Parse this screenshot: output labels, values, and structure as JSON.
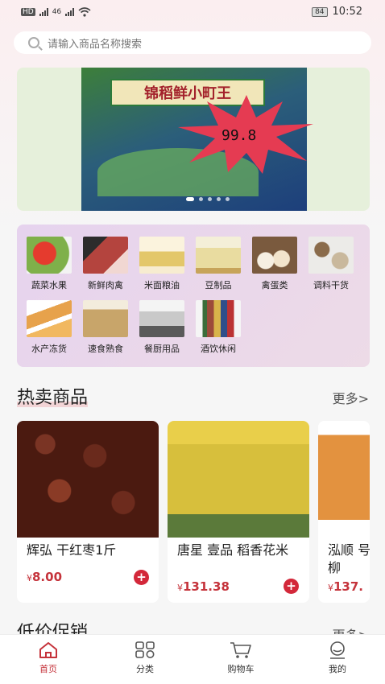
{
  "status_bar": {
    "left_badges": [
      "HD",
      "46"
    ],
    "battery": "84",
    "time": "10:52"
  },
  "search": {
    "placeholder": "请输入商品名称搜索"
  },
  "banner": {
    "product_text": "锦稻鲜小町王",
    "price": "99.8",
    "slide_count": 5,
    "active_slide": 1
  },
  "categories": [
    {
      "label": "蔬菜水果",
      "color": "#7fb04a"
    },
    {
      "label": "新鲜肉禽",
      "color": "#b4443e"
    },
    {
      "label": "米面粮油",
      "color": "#e3c76a"
    },
    {
      "label": "豆制品",
      "color": "#e9dca0"
    },
    {
      "label": "禽蛋类",
      "color": "#d7c2a7"
    },
    {
      "label": "调料干货",
      "color": "#b8a892"
    },
    {
      "label": "水产冻货",
      "color": "#e7a24b"
    },
    {
      "label": "速食熟食",
      "color": "#c8a56a"
    },
    {
      "label": "餐厨用品",
      "color": "#c9c9c9"
    },
    {
      "label": "酒饮休闲",
      "color": "#9c4b3a"
    }
  ],
  "hot": {
    "title": "热卖商品",
    "more": "更多>",
    "products": [
      {
        "name": "辉弘 干红枣1斤",
        "currency": "¥",
        "price": "8.00",
        "add": "+"
      },
      {
        "name": "唐星 壹品 稻香花米",
        "currency": "¥",
        "price": "131.38",
        "add": "+"
      },
      {
        "name": "泓顺 号鸡柳",
        "currency": "¥",
        "price": "137.",
        "add": "+"
      }
    ]
  },
  "promo": {
    "title": "低价促销",
    "more": "更多>"
  },
  "nav": [
    {
      "label": "首页",
      "icon": "home-icon",
      "active": true
    },
    {
      "label": "分类",
      "icon": "category-icon",
      "active": false
    },
    {
      "label": "购物车",
      "icon": "cart-icon",
      "active": false
    },
    {
      "label": "我的",
      "icon": "profile-icon",
      "active": false
    }
  ],
  "colors": {
    "accent": "#c5333b",
    "add_button": "#d3283a"
  }
}
